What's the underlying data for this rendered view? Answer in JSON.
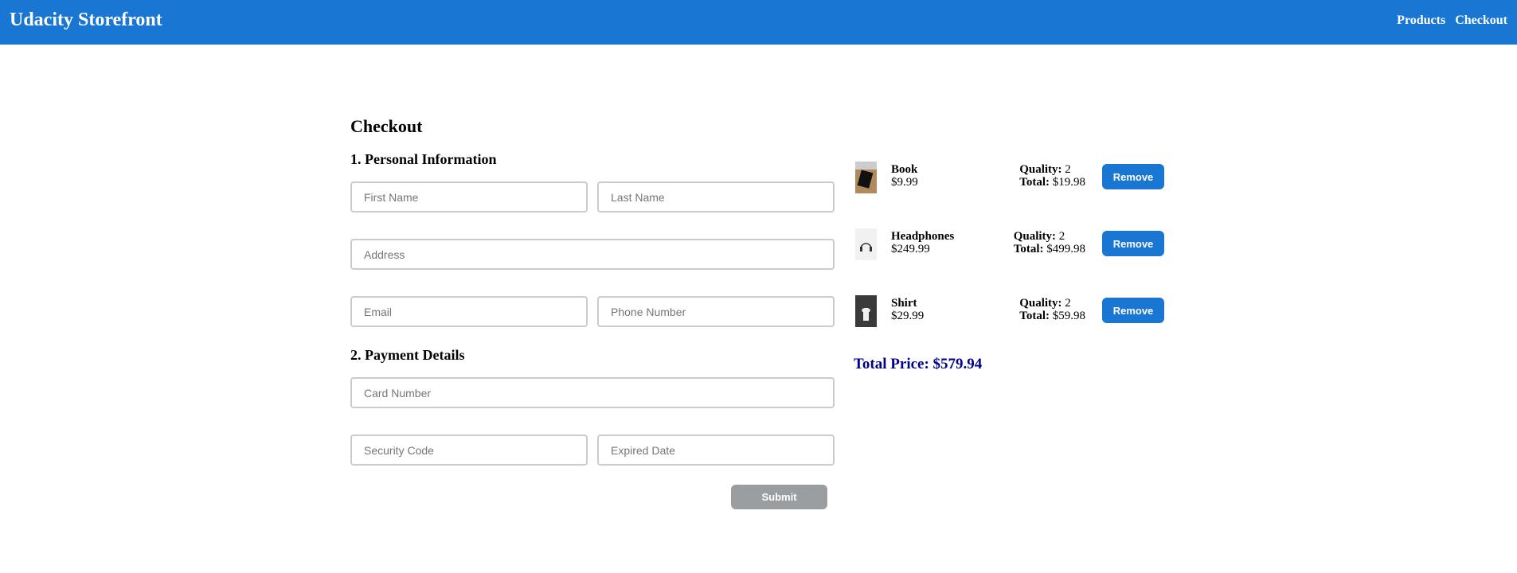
{
  "header": {
    "brand": "Udacity Storefront",
    "nav": [
      "Products",
      "Checkout"
    ],
    "color": "#1976d2"
  },
  "checkout": {
    "title": "Checkout",
    "personal_heading": "1. Personal Information",
    "payment_heading": "2. Payment Details",
    "fields": {
      "first_name": "First Name",
      "last_name": "Last Name",
      "address": "Address",
      "email": "Email",
      "phone": "Phone Number",
      "card": "Card Number",
      "security": "Security Code",
      "expiry": "Expired Date"
    },
    "submit": "Submit"
  },
  "cart": {
    "items": [
      {
        "name": "Book",
        "price": "$9.99",
        "quantity_label": "Quality:",
        "quantity": "2",
        "total_label": "Total:",
        "total": "$19.98",
        "remove": "Remove",
        "image": "book"
      },
      {
        "name": "Headphones",
        "price": "$249.99",
        "quantity_label": "Quality:",
        "quantity": "2",
        "total_label": "Total:",
        "total": "$499.98",
        "remove": "Remove",
        "image": "headphones"
      },
      {
        "name": "Shirt",
        "price": "$29.99",
        "quantity_label": "Quality:",
        "quantity": "2",
        "total_label": "Total:",
        "total": "$59.98",
        "remove": "Remove",
        "image": "shirt"
      }
    ],
    "total_price": "Total Price: $579.94"
  }
}
